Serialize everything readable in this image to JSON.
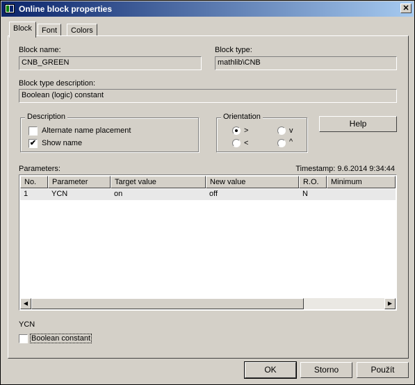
{
  "window": {
    "title": "Online block properties",
    "close_glyph": "✕"
  },
  "tabs": [
    {
      "label": "Block"
    },
    {
      "label": "Font"
    },
    {
      "label": "Colors"
    }
  ],
  "block_name": {
    "label": "Block name:",
    "value": "CNB_GREEN"
  },
  "block_type": {
    "label": "Block type:",
    "value": "mathlib\\CNB"
  },
  "block_type_description": {
    "label": "Block type description:",
    "value": "Boolean (logic) constant"
  },
  "description_group": {
    "title": "Description",
    "alternate_name": {
      "label": "Alternate name placement",
      "checked": false
    },
    "show_name": {
      "label": "Show name",
      "checked": true,
      "mark": "✔"
    }
  },
  "orientation_group": {
    "title": "Orientation",
    "options": [
      {
        "label": ">",
        "selected": true
      },
      {
        "label": "v",
        "selected": false
      },
      {
        "label": "<",
        "selected": false
      },
      {
        "label": "^",
        "selected": false
      }
    ]
  },
  "help_button": {
    "label": "Help"
  },
  "parameters": {
    "label": "Parameters:",
    "timestamp": "Timestamp: 9.6.2014 9:34:44",
    "columns": [
      "No.",
      "Parameter",
      "Target value",
      "New value",
      "R.O.",
      "Minimum"
    ],
    "rows": [
      [
        "1",
        "YCN",
        "on",
        "off",
        "N",
        ""
      ]
    ],
    "scroll_left": "◀",
    "scroll_right": "▶"
  },
  "param_editor": {
    "name": "YCN",
    "checkbox_label": "Boolean constant",
    "checked": false
  },
  "footer": {
    "ok_label": "OK",
    "cancel_label": "Storno",
    "apply_label": "Použít"
  }
}
